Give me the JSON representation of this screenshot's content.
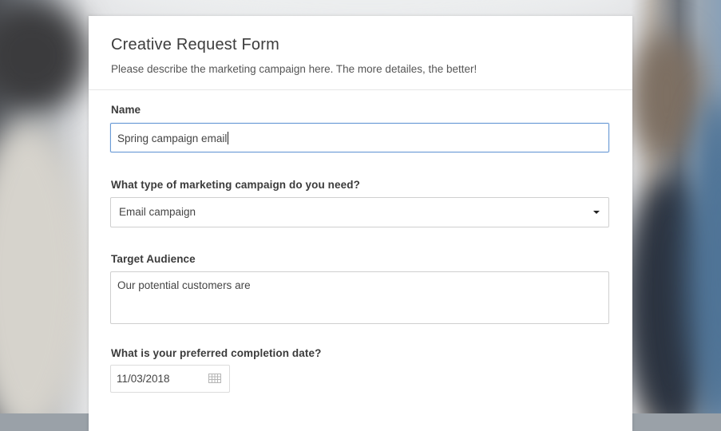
{
  "form": {
    "title": "Creative Request Form",
    "description": "Please describe the marketing campaign here. The more detailes, the better!"
  },
  "fields": {
    "name": {
      "label": "Name",
      "value": "Spring campaign email"
    },
    "campaign_type": {
      "label": "What type of marketing campaign do you need?",
      "selected": "Email campaign"
    },
    "target_audience": {
      "label": "Target Audience",
      "value": "Our potential customers are"
    },
    "completion_date": {
      "label": "What is your preferred completion date?",
      "value": "11/03/2018"
    }
  },
  "icons": {
    "dropdown": "chevron-down-icon",
    "date_picker": "calendar-icon"
  },
  "colors": {
    "focus_border": "#6b9bd6",
    "title_text": "#3d3d3d",
    "card_background": "#ffffff"
  }
}
